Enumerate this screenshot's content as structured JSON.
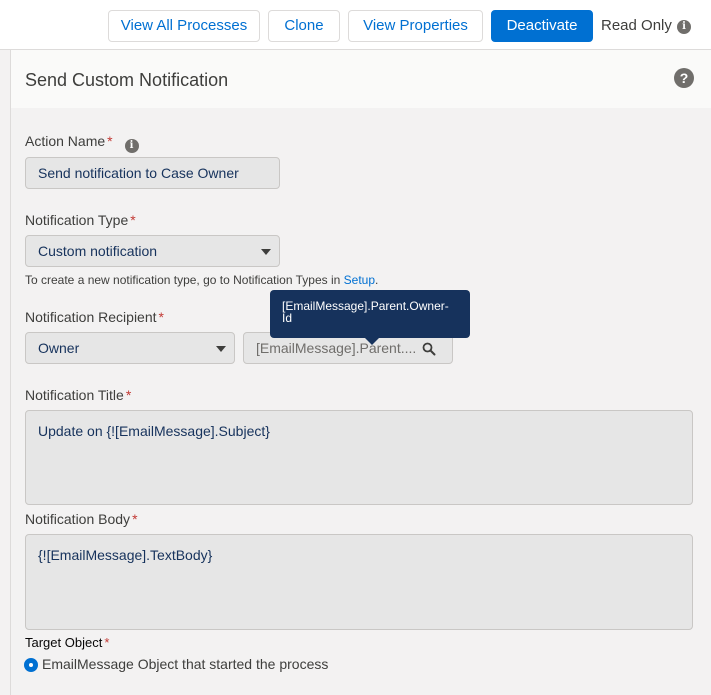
{
  "toolbar": {
    "view_all_processes": "View All Processes",
    "clone": "Clone",
    "view_properties": "View Properties",
    "deactivate": "Deactivate",
    "read_only": "Read Only"
  },
  "panel": {
    "title": "Send Custom Notification"
  },
  "form": {
    "action_name": {
      "label": "Action Name",
      "value": "Send notification to Case Owner"
    },
    "notification_type": {
      "label": "Notification Type",
      "value": "Custom notification",
      "help_prefix": "To create a new notification type, go to Notification Types in ",
      "help_link": "Setup",
      "help_suffix": "."
    },
    "notification_recipient": {
      "label": "Notification Recipient",
      "value": "Owner",
      "lookup_value": "[EmailMessage].Parent....",
      "tooltip": "[EmailMessage].Parent.Owner-Id"
    },
    "notification_title": {
      "label": "Notification Title",
      "value": "Update on {![EmailMessage].Subject}"
    },
    "notification_body": {
      "label": "Notification Body",
      "value": "{![EmailMessage].TextBody}"
    },
    "target_object": {
      "label": "Target Object",
      "option": "EmailMessage Object that started the process"
    }
  },
  "colors": {
    "brand": "#0070d2",
    "tooltip_bg": "#16325c",
    "required": "#c23934"
  }
}
